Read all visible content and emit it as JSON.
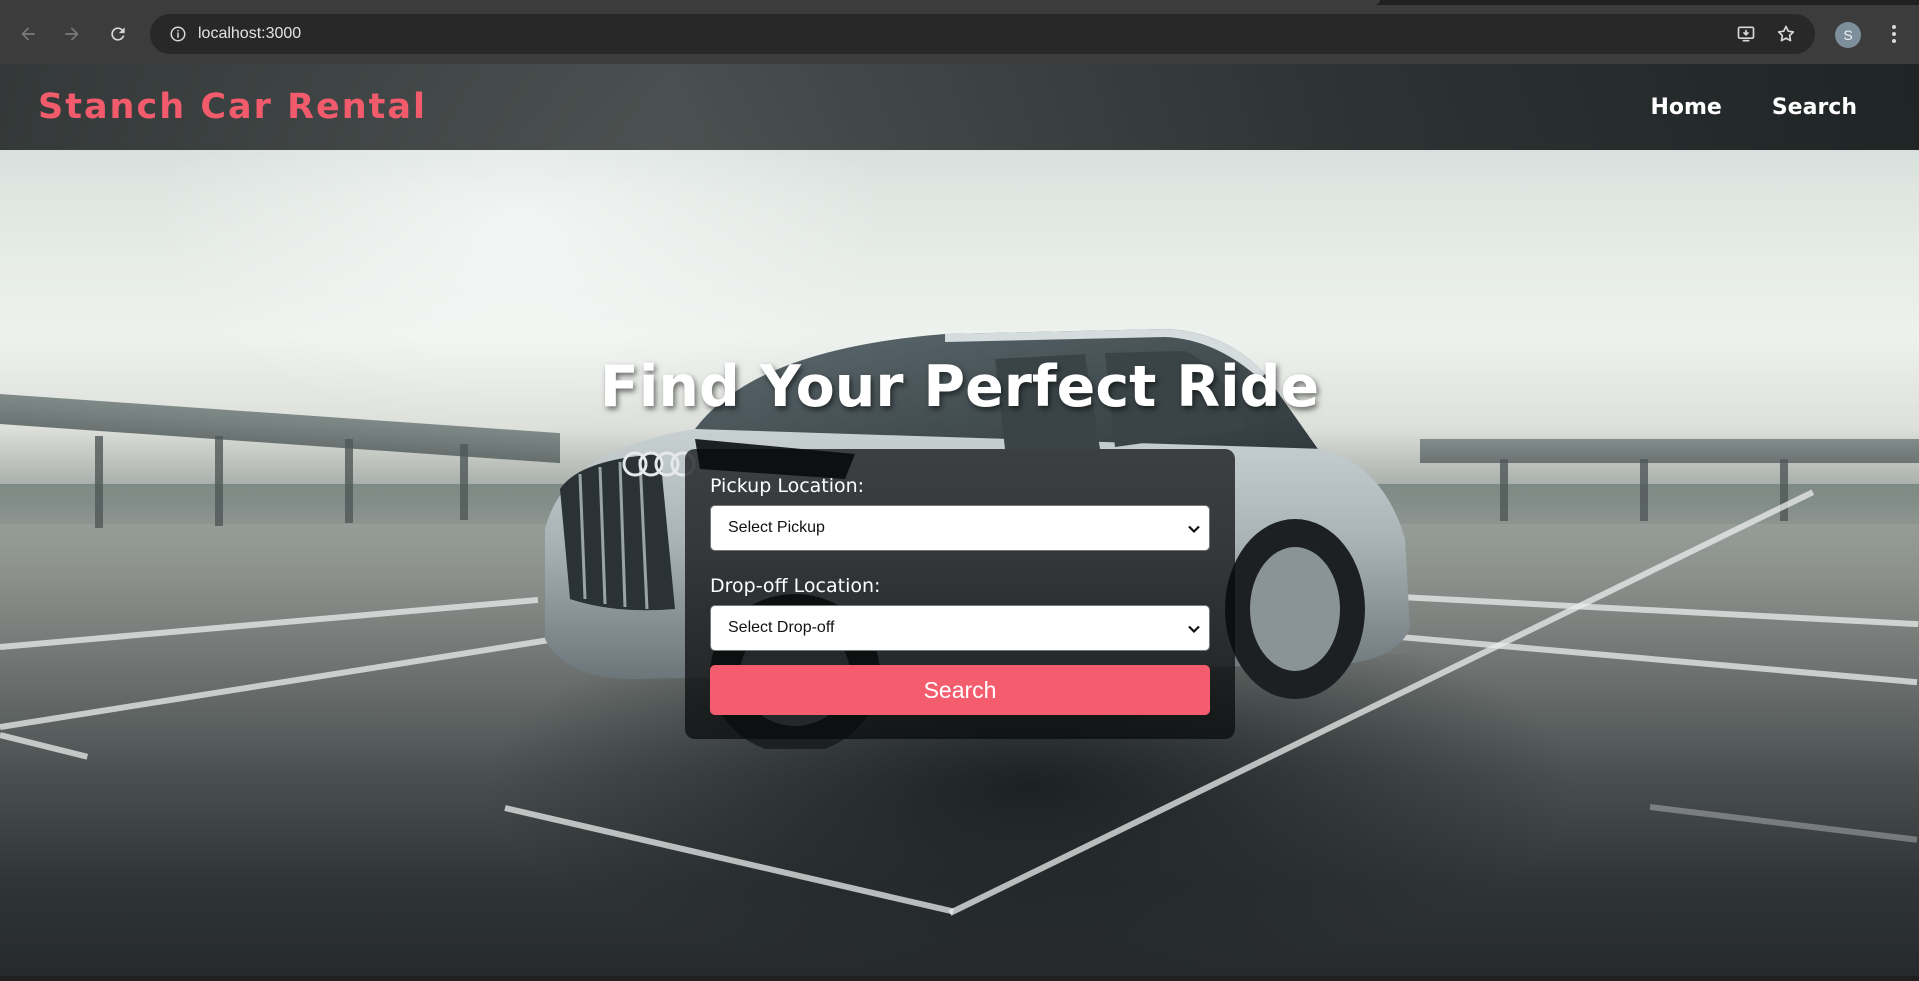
{
  "browser": {
    "url": "localhost:3000",
    "profile_initial": "S",
    "icons": {
      "back": "arrow-left-icon",
      "forward": "arrow-right-icon",
      "reload": "reload-icon",
      "site_info": "info-icon",
      "install": "install-app-icon",
      "bookmark": "star-icon",
      "menu": "kebab-menu-icon"
    }
  },
  "header": {
    "brand": "Stanch Car Rental",
    "nav": [
      {
        "label": "Home"
      },
      {
        "label": "Search"
      }
    ]
  },
  "hero": {
    "title": "Find Your Perfect Ride",
    "pickup": {
      "label": "Pickup Location:",
      "selected": "Select Pickup"
    },
    "dropoff": {
      "label": "Drop-off Location:",
      "selected": "Select Drop-off"
    },
    "search_button": "Search"
  },
  "colors": {
    "brand": "#f15b6c",
    "button": "#f45d6e",
    "card": "rgba(8,10,11,0.72)",
    "browser_chrome": "#3c3c3c"
  }
}
